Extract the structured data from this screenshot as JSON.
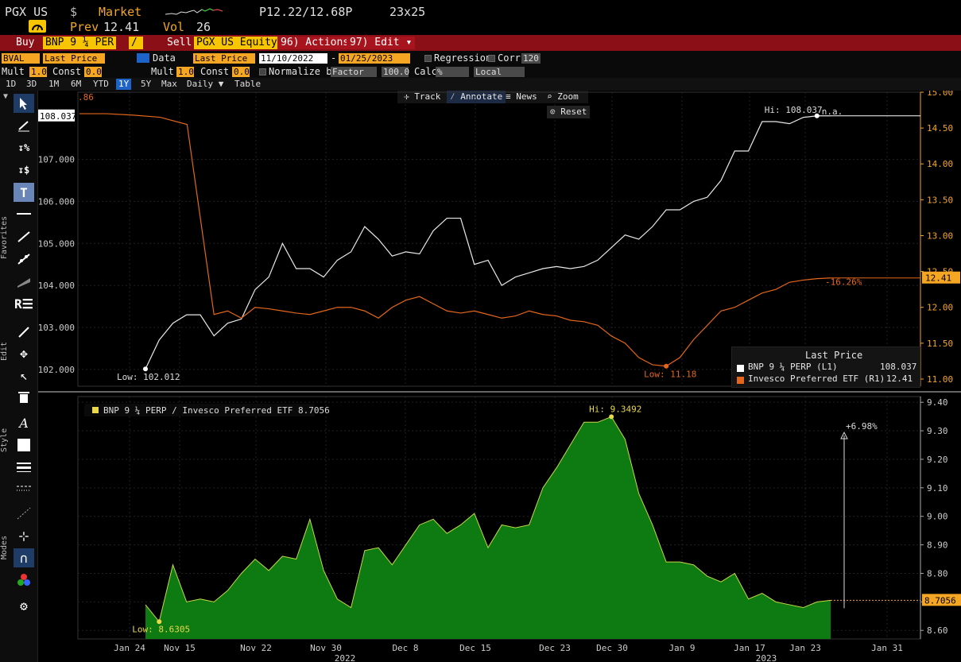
{
  "header": {
    "ticker": "PGX US",
    "currency": "$",
    "market_label": "Market",
    "price_range": "P12.22/12.68P",
    "size": "23x25",
    "prev_label": "Prev",
    "prev_value": "12.41",
    "vol_label": "Vol",
    "vol_value": "26"
  },
  "trade_bar": {
    "buy_label": "Buy",
    "buy_security": "BNP 9 ¼ PER",
    "slash": "/",
    "sell_label": "Sell",
    "sell_security": "PGX US Equity",
    "actions_label": "96) Actions",
    "edit_label": "97) Edit"
  },
  "toolbar": {
    "source": "BVAL",
    "field1": "Last Price",
    "data_label": "Data",
    "field2": "Last Price",
    "start_date": "11/10/2022",
    "end_date": "01/25/2023",
    "regression_label": "Regression",
    "corr_label": "Corr",
    "corr_value": "120",
    "mult_label1": "Mult",
    "mult_value1": "1.0",
    "const_label1": "Const",
    "const_value1": "0.0",
    "mult_label2": "Mult",
    "mult_value2": "1.0",
    "const_label2": "Const",
    "const_value2": "0.0",
    "normalize_label": "Normalize by",
    "normalize_value": "Factor",
    "normalize_num": "100.0",
    "calc_label": "Calc",
    "calc_value": "%",
    "currency_value": "Local"
  },
  "periods": [
    "1D",
    "3D",
    "1M",
    "6M",
    "YTD",
    "1Y",
    "5Y",
    "Max"
  ],
  "selected_period": "1Y",
  "daily_label": "Daily ▼",
  "table_label": "Table",
  "chart_tools": {
    "track": "Track",
    "annotate": "Annotate",
    "news": "News",
    "zoom": "Zoom",
    "reset": "Reset"
  },
  "side_labels": {
    "favorites": "Favorites",
    "edit": "Edit",
    "style": "Style",
    "modes": "Modes"
  },
  "colors": {
    "white_series": "#e8e8e8",
    "orange_series": "#e3661a",
    "area_fill": "#0d7a12",
    "area_line": "#c8d84a",
    "bbg_orange": "#f5a623",
    "bbg_red": "#8b0f16"
  },
  "chart_data": [
    {
      "type": "line",
      "x_ticks": [
        "Jan 24",
        "Nov 15",
        "Nov 22",
        "Nov 30",
        "Dec 8",
        "Dec 15",
        "Dec 23",
        "Dec 30",
        "Jan 9",
        "Jan 17",
        "Jan 23",
        "Jan 31"
      ],
      "year_labels": [
        "2022",
        "2023"
      ],
      "left_axis": {
        "ticks": [
          "102.000",
          "103.000",
          "104.000",
          "105.000",
          "106.000",
          "107.000"
        ],
        "ylim": [
          101.6,
          108.6
        ]
      },
      "right_axis": {
        "ticks": [
          "11.00",
          "11.50",
          "12.00",
          "12.50",
          "13.00",
          "13.50",
          "14.00",
          "14.50",
          "15.00"
        ],
        "ylim": [
          10.9,
          15.0
        ]
      },
      "current_left": "108.037",
      "current_right": "12.41",
      "top_left_value": ".86",
      "series": [
        {
          "name": "BNP 9 ¼ PERP (L1)",
          "axis": "left",
          "values": [
            102.012,
            102.7,
            103.1,
            103.3,
            103.3,
            102.8,
            103.1,
            103.2,
            103.9,
            104.2,
            105.0,
            104.4,
            104.4,
            104.2,
            104.6,
            104.8,
            105.4,
            105.1,
            104.7,
            104.8,
            104.75,
            105.3,
            105.6,
            105.6,
            104.5,
            104.6,
            104.0,
            104.2,
            104.3,
            104.4,
            104.45,
            104.4,
            104.45,
            104.6,
            104.9,
            105.2,
            105.1,
            105.4,
            105.8,
            105.8,
            106.0,
            106.1,
            106.5,
            107.2,
            107.2,
            107.9,
            107.9,
            107.85,
            108.0,
            108.037,
            108.037
          ]
        },
        {
          "name": "Invesco Preferred ETF (R1)",
          "axis": "right",
          "values": [
            14.7,
            14.7,
            14.68,
            14.65,
            14.55,
            11.9,
            11.95,
            11.85,
            12.0,
            11.98,
            11.95,
            11.92,
            11.9,
            11.95,
            12.0,
            12.0,
            11.95,
            11.85,
            12.0,
            12.1,
            12.15,
            12.05,
            11.95,
            11.92,
            11.95,
            11.9,
            11.85,
            11.88,
            11.95,
            11.9,
            11.88,
            11.82,
            11.8,
            11.75,
            11.6,
            11.5,
            11.3,
            11.2,
            11.18,
            11.3,
            11.55,
            11.75,
            11.95,
            12.0,
            12.1,
            12.2,
            12.25,
            12.35,
            12.38,
            12.4,
            12.41
          ]
        }
      ],
      "annotations": {
        "low_label": "Low: 102.012",
        "hi_label": "Hi: 108.037",
        "na_label": "n.a.",
        "orange_low_label": "Low: 11.18",
        "pct_change": "-16.26%"
      },
      "legend": {
        "title": "Last Price",
        "items": [
          {
            "name": "BNP 9 ¼ PERP (L1)",
            "value": "108.037"
          },
          {
            "name": "Invesco Preferred ETF (R1)",
            "value": "12.41"
          }
        ]
      }
    },
    {
      "type": "area",
      "title": "BNP 9 ¼ PERP / Invesco Preferred ETF 8.7056",
      "y_ticks": [
        "8.60",
        "8.70",
        "8.80",
        "8.90",
        "9.00",
        "9.10",
        "9.20",
        "9.30",
        "9.40"
      ],
      "ylim": [
        8.57,
        9.42
      ],
      "values": [
        8.69,
        8.6305,
        8.83,
        8.7,
        8.71,
        8.7,
        8.74,
        8.8,
        8.85,
        8.81,
        8.86,
        8.85,
        8.99,
        8.81,
        8.71,
        8.68,
        8.88,
        8.89,
        8.83,
        8.9,
        8.97,
        8.99,
        8.94,
        8.97,
        9.01,
        8.89,
        8.97,
        8.96,
        8.97,
        9.1,
        9.17,
        9.25,
        9.33,
        9.33,
        9.3492,
        9.27,
        9.08,
        8.97,
        8.84,
        8.84,
        8.83,
        8.79,
        8.77,
        8.8,
        8.71,
        8.73,
        8.7,
        8.69,
        8.68,
        8.7,
        8.7056
      ],
      "current_value": "8.7056",
      "low_label": "Low: 8.6305",
      "hi_label": "Hi: 9.3492",
      "pct_label": "+6.98%"
    }
  ]
}
